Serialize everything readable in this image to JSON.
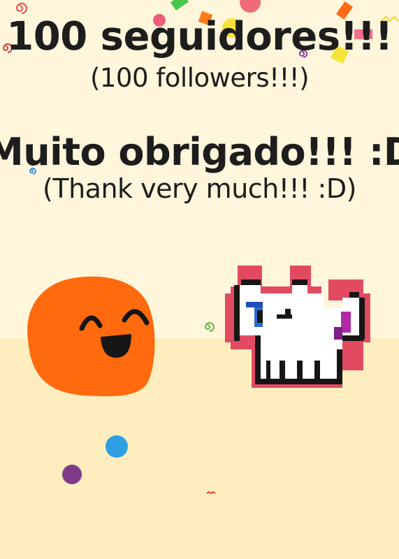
{
  "headline": {
    "pt_followers": "100 seguidores!!!",
    "en_followers": "(100 followers!!!)",
    "pt_thanks": "Muito obrigado!!! :D",
    "en_thanks": "(Thank very much!!! :D)"
  },
  "characters": {
    "blob_icon": "orange-blob-smiling",
    "cat_icon": "pixel-cat-winking"
  },
  "colors": {
    "wall": "#fff6dc",
    "floor": "#feeebf",
    "blob": "#ff6a0e",
    "cat_outline": "#e24a62",
    "cat_body": "#ffffff",
    "text": "#1d1d1d"
  }
}
